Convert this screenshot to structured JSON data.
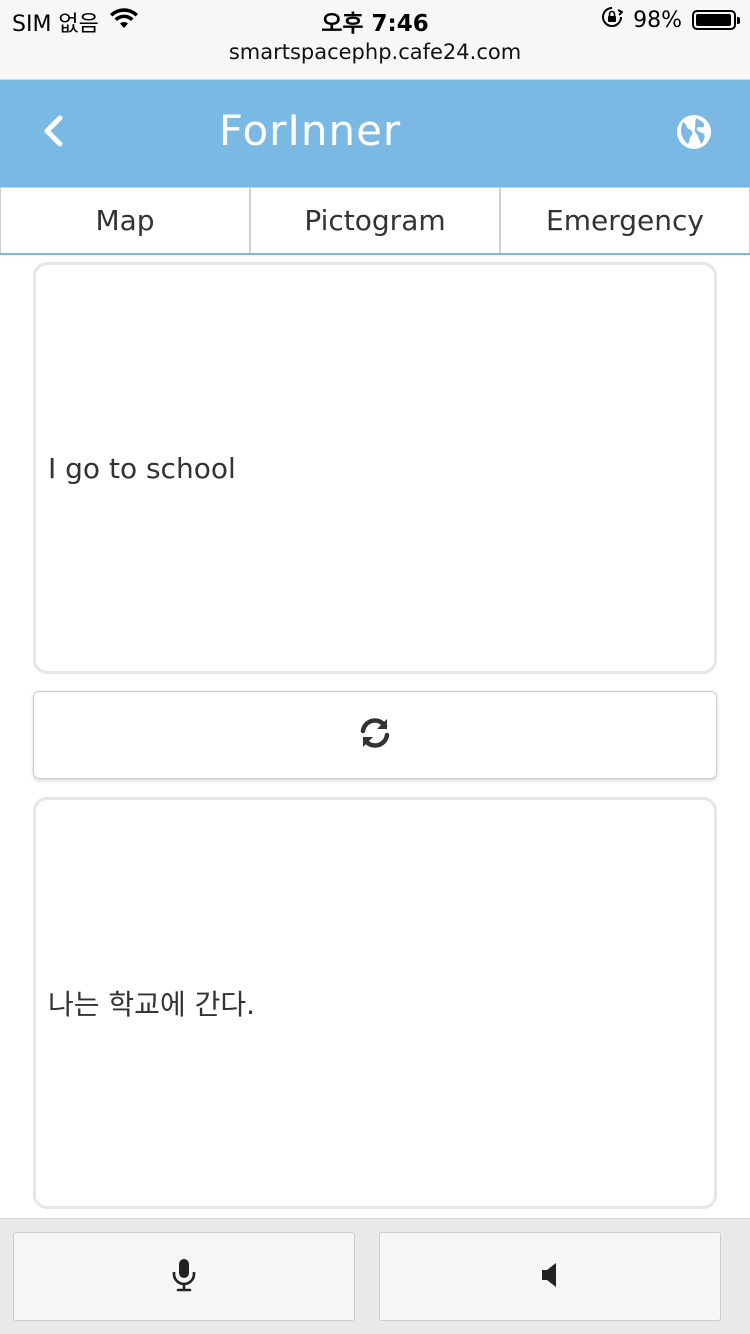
{
  "status_bar": {
    "carrier": "SIM 없음",
    "time": "오후 7:46",
    "battery": "98%",
    "battery_level": 0.98,
    "url": "smartspacephp.cafe24.com"
  },
  "header": {
    "title": "ForInner",
    "back_icon": "chevron-left-icon",
    "language_icon": "globe-icon",
    "background_color": "#7ab9e4"
  },
  "tabs": [
    {
      "label": "Map"
    },
    {
      "label": "Pictogram"
    },
    {
      "label": "Emergency"
    }
  ],
  "translation": {
    "source_text": "I go to school",
    "target_text": "나는 학교에 간다.",
    "swap_icon": "refresh-icon"
  },
  "footer": {
    "mic_icon": "microphone-icon",
    "speaker_icon": "speaker-icon"
  }
}
